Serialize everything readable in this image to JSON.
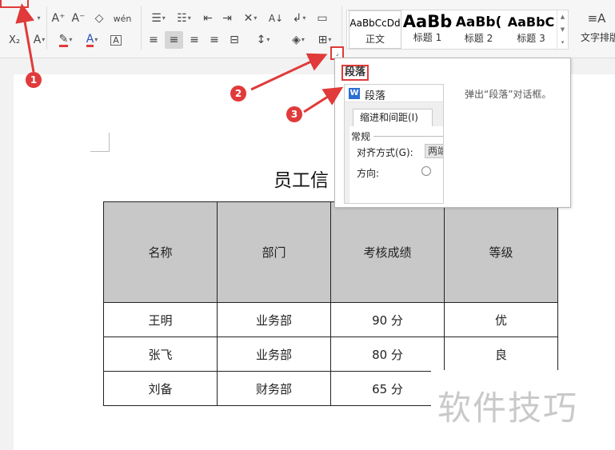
{
  "ribbon": {
    "row1": {
      "font_grow": "A⁺",
      "font_shrink": "A⁻",
      "clear_format": "◇",
      "pinyin": "wén",
      "bullets": "☰",
      "numbering": "☷",
      "decrease_indent": "⇤",
      "increase_indent": "⇥",
      "chinese_layout": "✕",
      "sort": "A↓",
      "line_break": "↲",
      "show_marks": "▭"
    },
    "row2": {
      "subscript": "X₂",
      "text_effect": "A",
      "highlight": "✎",
      "font_color": "A",
      "char_border": "A",
      "align_left": "≡",
      "align_center": "≡",
      "align_right": "≡",
      "justify": "≡",
      "distributed": "⊟",
      "line_spacing": "↕",
      "shading": "◈",
      "borders": "⊞"
    },
    "styles": [
      {
        "sample": "AaBbCcDd",
        "name": "正文"
      },
      {
        "sample": "AaBb",
        "name": "标题 1"
      },
      {
        "sample": "AaBb(",
        "name": "标题 2"
      },
      {
        "sample": "AaBbC",
        "name": "标题 3"
      }
    ],
    "text_layout": {
      "icon": "≡A",
      "label": "文字排版"
    },
    "launcher_icon": "⌟"
  },
  "popup": {
    "title": "段落",
    "description": "弹出“段落”对话框。",
    "dialog_title": "段落",
    "dialog_logo": "W",
    "tab": "缩进和间距(I)",
    "section": "常规",
    "alignment_label": "对齐方式(G):",
    "alignment_value": "两端",
    "direction_label": "方向:"
  },
  "document": {
    "title": "员工信",
    "table": {
      "headers": [
        "名称",
        "部门",
        "考核成绩",
        "等级"
      ],
      "rows": [
        [
          "王明",
          "业务部",
          "90 分",
          "优"
        ],
        [
          "张飞",
          "业务部",
          "80 分",
          "良"
        ],
        [
          "刘备",
          "财务部",
          "65 分",
          ""
        ]
      ]
    }
  },
  "annotations": {
    "step1": "1",
    "step2": "2",
    "step3": "3"
  },
  "watermark": "软件技巧",
  "colors": {
    "annotation_red": "#e03a3a",
    "header_gray": "#c8c8c8"
  }
}
